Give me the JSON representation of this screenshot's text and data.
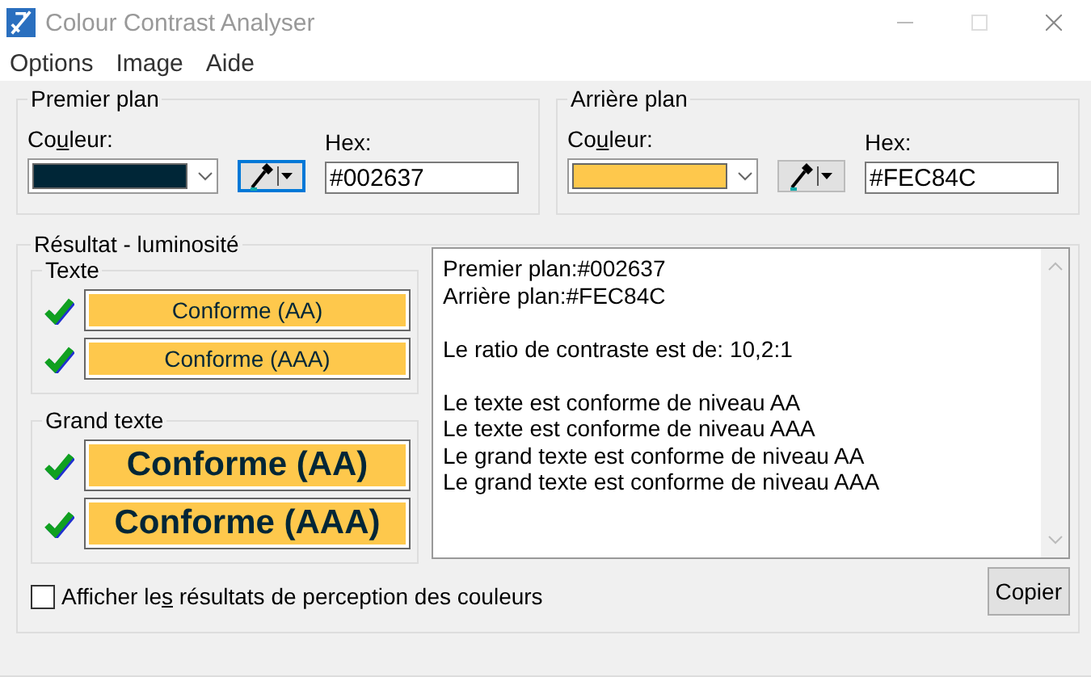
{
  "window": {
    "title": "Colour Contrast Analyser"
  },
  "menu": [
    "Options",
    "Image",
    "Aide"
  ],
  "panels": [
    {
      "title": "Premier plan",
      "colour_label": {
        "before": "Co",
        "key": "u",
        "after": "leur:"
      },
      "color": "#002637",
      "hex_label": "Hex:",
      "hex": "#002637",
      "picker_focused": true
    },
    {
      "title": "Arrière plan",
      "colour_label": {
        "before": "Co",
        "key": "u",
        "after": "leur:"
      },
      "color": "#FEC84C",
      "hex_label": "Hex:",
      "hex": "#FEC84C",
      "picker_focused": false
    }
  ],
  "result": {
    "title": "Résultat - luminosité",
    "groups": [
      {
        "title": "Texte",
        "kind": "normal",
        "items": [
          {
            "label": "Conforme (AA)",
            "passed": true
          },
          {
            "label": "Conforme (AAA)",
            "passed": true
          }
        ]
      },
      {
        "title": "Grand texte",
        "kind": "large",
        "items": [
          {
            "label": "Conforme (AA)",
            "passed": true
          },
          {
            "label": "Conforme (AAA)",
            "passed": true
          }
        ]
      }
    ],
    "report": [
      [
        "Premier plan:#002637",
        "Arrière plan:#FEC84C"
      ],
      [
        "Le ratio de contraste est de: 10,2:1"
      ],
      [
        "Le texte est conforme de niveau AA",
        "Le texte est conforme de niveau AAA",
        "Le grand texte est conforme de niveau AA",
        "Le grand texte est conforme de niveau AAA"
      ]
    ],
    "checkbox": {
      "before": "Afficher le",
      "key": "s",
      "after": " résultats de perception des couleurs",
      "checked": false
    },
    "copy_button": "Copier"
  }
}
